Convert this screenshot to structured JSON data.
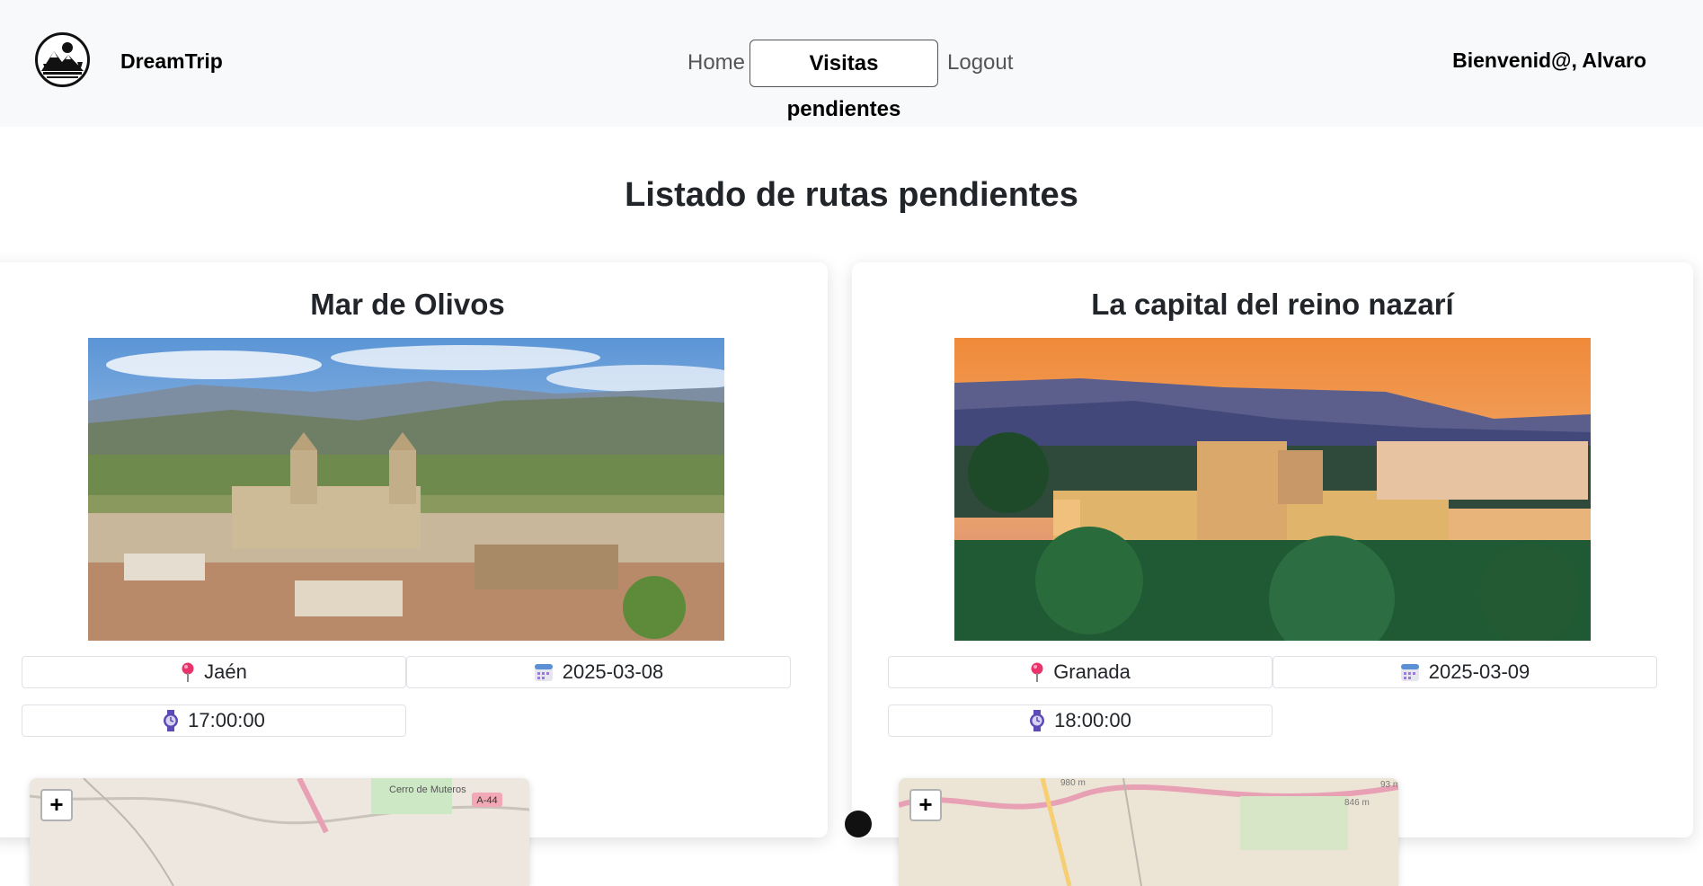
{
  "navbar": {
    "brand": "DreamTrip",
    "links": {
      "home": "Home",
      "pending": "Visitas pendientes",
      "logout": "Logout"
    },
    "welcome": "Bienvenid@, Alvaro",
    "logo_icon": "mountain-logo-icon"
  },
  "page": {
    "title": "Listado de rutas pendientes"
  },
  "routes": [
    {
      "title": "Mar de Olivos",
      "location": "Jaén",
      "date": "2025-03-08",
      "time": "17:00:00",
      "map_labels": {
        "place": "Cerro de Muteros",
        "road": "A-44"
      },
      "zoom_in": "+"
    },
    {
      "title": "La capital del reino nazarí",
      "location": "Granada",
      "date": "2025-03-09",
      "time": "18:00:00",
      "map_labels": {
        "elev1": "980 m",
        "elev2": "846 m",
        "elev3": "93 m"
      },
      "zoom_in": "+"
    }
  ],
  "icons": {
    "location": "pin-icon",
    "date": "calendar-icon",
    "time": "watch-icon"
  },
  "colors": {
    "navbar_bg": "#f8f9fa",
    "pin": "#e8336b",
    "calendar": "#5b8fd6",
    "watch": "#5b4bb7"
  }
}
